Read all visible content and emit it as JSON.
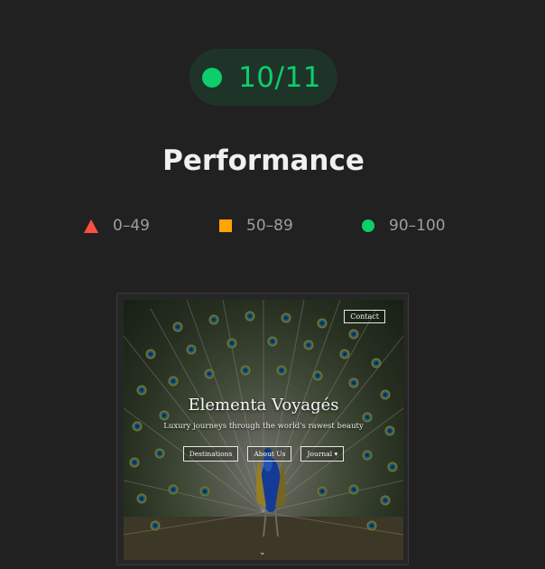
{
  "score": {
    "value": "10/11",
    "color": "#0cce6b"
  },
  "category_title": "Performance",
  "legend": [
    {
      "label": "0–49",
      "icon": "triangle-icon",
      "color": "#ff4e42"
    },
    {
      "label": "50–89",
      "icon": "square-icon",
      "color": "#ffa400"
    },
    {
      "label": "90–100",
      "icon": "circle-icon",
      "color": "#0cce6b"
    }
  ],
  "thumbnail": {
    "site_name": "Elementa Voyagés",
    "tagline": "Luxury journeys through the world's rawest beauty",
    "contact_label": "Contact",
    "nav": [
      "Destinations",
      "About Us",
      "Journal ▾"
    ],
    "scroll_indicator": "⌄"
  }
}
